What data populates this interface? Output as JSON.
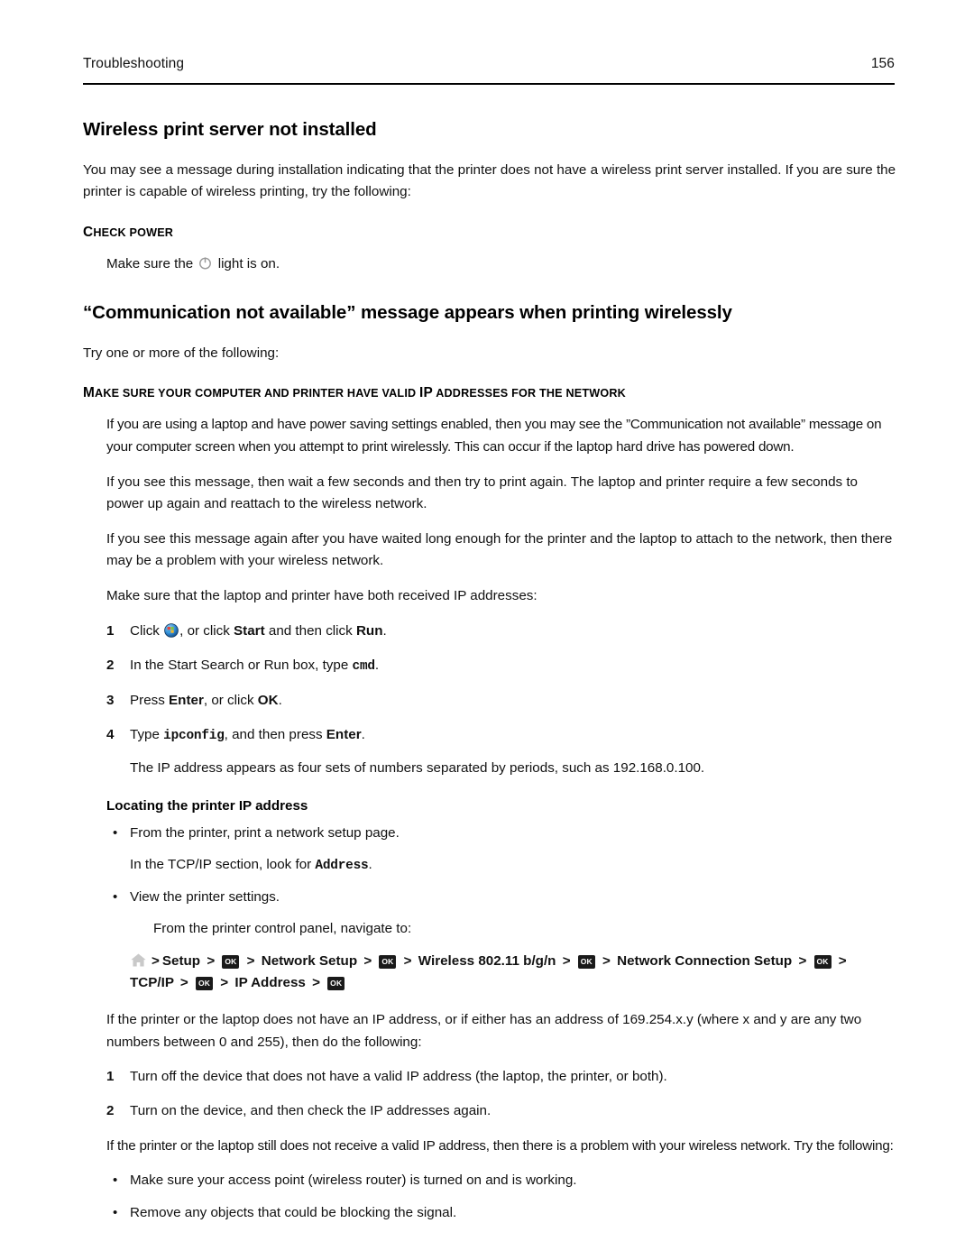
{
  "header": {
    "section": "Troubleshooting",
    "page_number": "156"
  },
  "sections": [
    {
      "heading": "Wireless print server not installed",
      "intro": "You may see a message during installation indicating that the printer does not have a wireless print server installed. If you are sure the printer is capable of wireless printing, try the following:",
      "check": {
        "title_first": "C",
        "title_rest": "HECK POWER",
        "text_before": "Make sure the ",
        "text_after": " light is on."
      }
    }
  ],
  "section2": {
    "heading": "“Communication not available” message appears when printing wirelessly",
    "intro": "Try one or more of the following:",
    "subhead": {
      "part1_big": "M",
      "part1_sm": "AKE SURE YOUR COMPUTER AND PRINTER HAVE VALID ",
      "part2_big": "IP",
      "part2_sm": " ADDRESSES FOR THE NETWORK"
    },
    "paragraphs": [
      "If you are using a laptop and have power saving settings enabled, then you may see the ”Communication not available” message on your computer screen when you attempt to print wirelessly. This can occur if the laptop hard drive has powered down.",
      "If you see this message, then wait a few seconds and then try to print again. The laptop and printer require a few seconds to power up again and reattach to the wireless network.",
      "If you see this message again after you have waited long enough for the printer and the laptop to attach to the network, then there may be a problem with your wireless network.",
      "Make sure that the laptop and printer have both received IP addresses:"
    ],
    "steps": [
      {
        "num": "1",
        "pre": "Click ",
        "mid": ", or click ",
        "bold1": "Start",
        "mid2": " and then click ",
        "bold2": "Run",
        "post": "."
      },
      {
        "num": "2",
        "pre": "In the Start Search or Run box, type ",
        "code": "cmd",
        "post": "."
      },
      {
        "num": "3",
        "pre": "Press ",
        "bold1": "Enter",
        "mid": ", or click ",
        "bold2": "OK",
        "post": "."
      },
      {
        "num": "4",
        "pre": "Type ",
        "code": "ipconfig",
        "mid": ", and then press ",
        "bold1": "Enter",
        "post": ".",
        "sub": "The IP address appears as four sets of numbers separated by periods, such as 192.168.0.100."
      }
    ],
    "locating": {
      "title": "Locating the printer IP address",
      "bullet1": "From the printer, print a network setup page.",
      "bullet1_sub_pre": "In the TCP/IP section, look for ",
      "bullet1_sub_code": "Address",
      "bullet1_sub_post": ".",
      "bullet2": "View the printer settings.",
      "bullet2_sub": "From the printer control panel, navigate to:"
    },
    "nav_path": {
      "sep": ">",
      "items": [
        {
          "type": "icon",
          "icon": "home-icon",
          "label": ""
        },
        {
          "type": "text",
          "label": "Setup"
        },
        {
          "type": "icon",
          "icon": "ok-button-icon",
          "label": "OK"
        },
        {
          "type": "text",
          "label": "Network Setup"
        },
        {
          "type": "icon",
          "icon": "ok-button-icon",
          "label": "OK"
        },
        {
          "type": "text",
          "label": "Wireless 802.11 b/g/n"
        },
        {
          "type": "icon",
          "icon": "ok-button-icon",
          "label": "OK"
        },
        {
          "type": "text",
          "label": "Network Connection Setup"
        },
        {
          "type": "icon",
          "icon": "ok-button-icon",
          "label": "OK"
        },
        {
          "type": "text",
          "label": "TCP/IP"
        },
        {
          "type": "icon",
          "icon": "ok-button-icon",
          "label": "OK"
        },
        {
          "type": "text",
          "label": "IP Address"
        },
        {
          "type": "icon",
          "icon": "ok-button-icon",
          "label": "OK"
        }
      ],
      "line1_text": "Setup",
      "line2_text": "TCP/IP",
      "ok_label": "OK"
    },
    "after_nav_paragraph": "If the printer or the laptop does not have an IP address, or if either has an address of 169.254.x.y (where x and y are any two numbers between 0 and 255), then do the following:",
    "steps2": [
      {
        "num": "1",
        "text": "Turn off the device that does not have a valid IP address (the laptop, the printer, or both)."
      },
      {
        "num": "2",
        "text": "Turn on the device, and then check the IP addresses again."
      }
    ],
    "closing_paragraph": "If the printer or the laptop still does not receive a valid IP address, then there is a problem with your wireless network. Try the following:",
    "closing_bullets": [
      "Make sure your access point (wireless router) is turned on and is working.",
      "Remove any objects that could be blocking the signal."
    ]
  },
  "icons": {
    "bullet_glyph": "•",
    "power_icon": "power-icon",
    "start_orb_icon": "windows-start-orb-icon",
    "home_icon": "home-icon"
  },
  "colors": {
    "text": "#111111",
    "rule": "#000000",
    "ok_button_bg": "#1a1a1a",
    "home_icon": "#c9c9c9",
    "power_icon": "#9a9a9a"
  }
}
